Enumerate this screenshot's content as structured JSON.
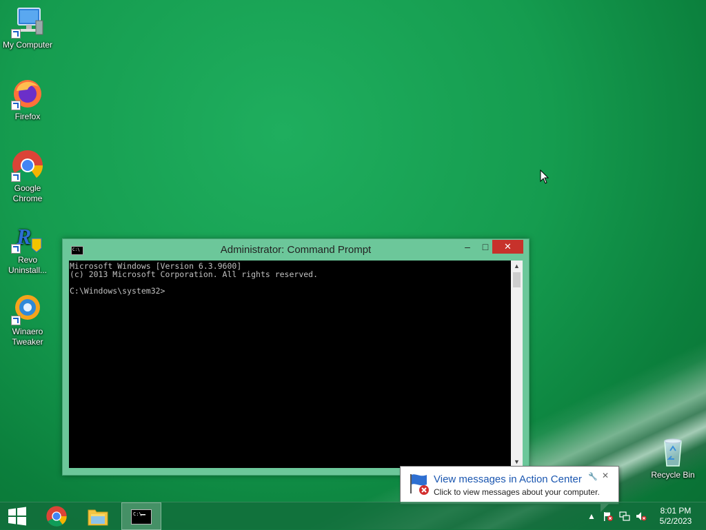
{
  "desktop": {
    "icons": [
      {
        "label": "My Computer"
      },
      {
        "label": "Firefox"
      },
      {
        "label": "Google Chrome"
      },
      {
        "label": "Revo Uninstall..."
      },
      {
        "label": "Winaero Tweaker"
      },
      {
        "label": "Recycle Bin"
      }
    ]
  },
  "cmd_window": {
    "title": "Administrator:  Command Prompt",
    "minimize": "–",
    "maximize": "□",
    "close": "✕",
    "console_text": "Microsoft Windows [Version 6.3.9600]\n(c) 2013 Microsoft Corporation. All rights reserved.\n\nC:\\Windows\\system32>"
  },
  "balloon": {
    "title": "View messages in Action Center",
    "text": "Click to view messages about your computer.",
    "close": "✕"
  },
  "taskbar": {
    "items": [
      {
        "icon": "windows-start-icon"
      },
      {
        "icon": "chrome-icon"
      },
      {
        "icon": "file-explorer-icon"
      },
      {
        "icon": "command-prompt-icon",
        "active": true
      }
    ],
    "tray": {
      "show_hidden": "▲"
    },
    "clock": {
      "time": "8:01 PM",
      "date": "5/2/2023"
    }
  },
  "colors": {
    "accent": "#6cc79a",
    "close_button": "#c7322b",
    "balloon_title": "#1a56b0"
  }
}
